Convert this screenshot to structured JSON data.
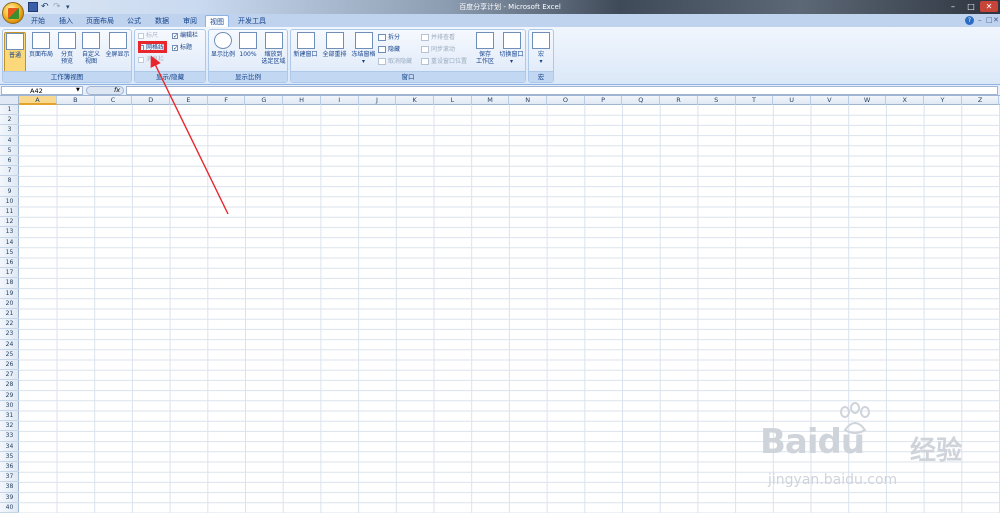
{
  "window": {
    "title": "百度分享计划 - Microsoft Excel",
    "min": "–",
    "max": "□",
    "close": "✕"
  },
  "qat": {
    "undo": "↶",
    "redo": "↷",
    "more": "▾"
  },
  "tabs": [
    "开始",
    "插入",
    "页面布局",
    "公式",
    "数据",
    "审阅",
    "视图",
    "开发工具"
  ],
  "active_tab": "视图",
  "ribbon": {
    "groups": {
      "workbook_views": "工作簿视图",
      "show_hide": "显示/隐藏",
      "zoom": "显示比例",
      "window": "窗口",
      "macros": "宏"
    },
    "workbook_views": {
      "normal": "普通",
      "page_layout": "页面布局",
      "page_break_1": "分页",
      "page_break_2": "预览",
      "custom_1": "自定义",
      "custom_2": "视图",
      "fullscreen": "全屏显示"
    },
    "show_hide": {
      "ruler": "标尺",
      "gridlines": "网格线",
      "message_bar": "消息栏",
      "formula_bar": "编辑栏",
      "headings": "标题"
    },
    "zoom": {
      "zoom": "显示比例",
      "hundred": "100%",
      "to_sel_1": "缩放到",
      "to_sel_2": "选定区域"
    },
    "window": {
      "new_window": "新建窗口",
      "arrange_all": "全部重排",
      "freeze_panes": "冻结窗格",
      "split": "拆分",
      "hide": "隐藏",
      "unhide": "取消隐藏",
      "side_by_side": "并排查看",
      "sync_scroll": "同步滚动",
      "reset_pos": "重设窗口位置",
      "save_ws_1": "保存",
      "save_ws_2": "工作区",
      "switch_windows": "切换窗口"
    },
    "macros": {
      "macros": "宏"
    }
  },
  "formula_bar": {
    "name_box": "A42",
    "fx": "fx"
  },
  "columns": [
    "A",
    "B",
    "C",
    "D",
    "E",
    "F",
    "G",
    "H",
    "I",
    "J",
    "K",
    "L",
    "M",
    "N",
    "O",
    "P",
    "Q",
    "R",
    "S",
    "T",
    "U",
    "V",
    "W",
    "X",
    "Y",
    "Z"
  ],
  "active_column": "A",
  "rows": [
    "1",
    "2",
    "3",
    "4",
    "5",
    "6",
    "7",
    "8",
    "9",
    "10",
    "11",
    "12",
    "13",
    "14",
    "15",
    "16",
    "17",
    "18",
    "19",
    "20",
    "21",
    "22",
    "23",
    "24",
    "25",
    "26",
    "27",
    "28",
    "29",
    "30",
    "31",
    "32",
    "33",
    "34",
    "35",
    "36",
    "37",
    "38",
    "39",
    "40"
  ],
  "watermark": {
    "brand": "Bai",
    "brand2": "du",
    "sub": "经验",
    "url": "jingyan.baidu.com"
  },
  "colors": {
    "ribbon_bg": "#dbe8f8",
    "highlight": "#e8262c",
    "annotation_arrow": "#e8262c"
  }
}
